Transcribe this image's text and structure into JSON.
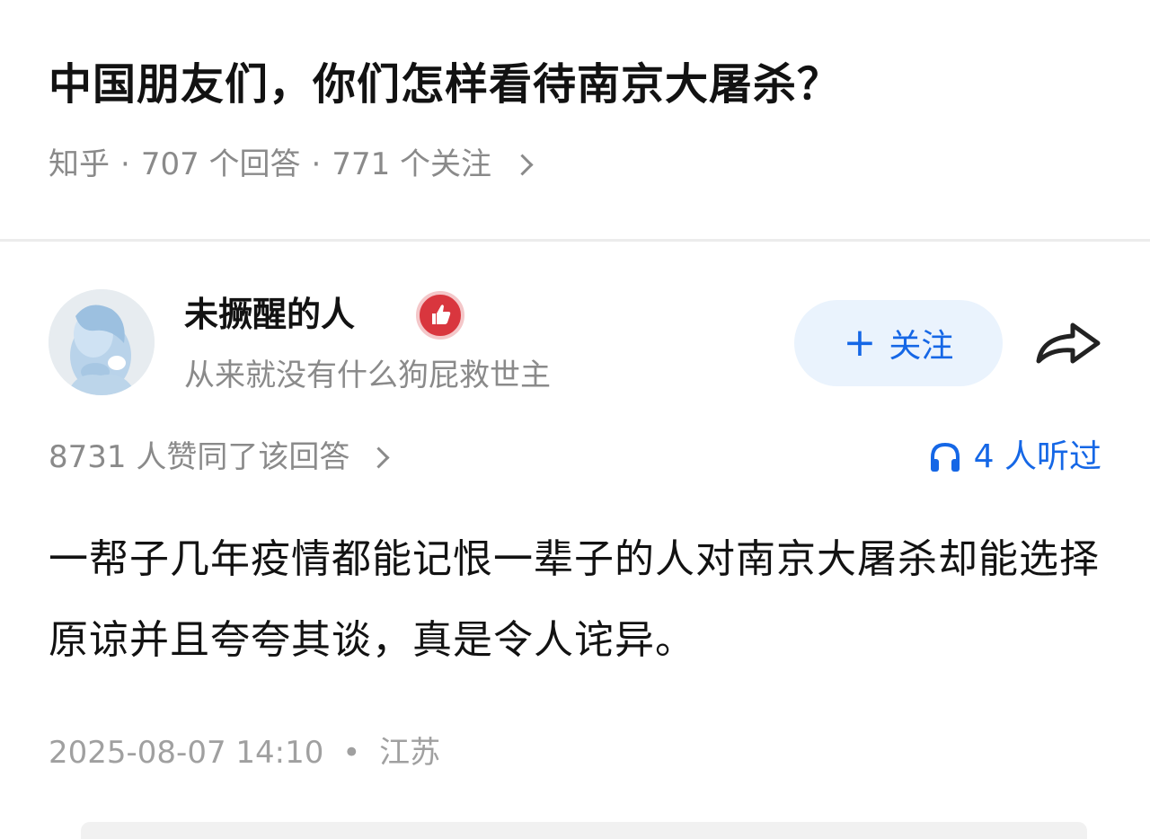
{
  "question": {
    "title": "中国朋友们，你们怎样看待南京大屠杀？",
    "source": "知乎",
    "answers_count": "707 个回答",
    "follow_count": "771 个关注",
    "separator": "·"
  },
  "author": {
    "name": "未撅醒的人",
    "bio": "从来就没有什么狗屁救世主",
    "badge_icon": "thumbs-up-badge-icon",
    "avatar_icon": "anime-avatar"
  },
  "actions": {
    "follow_plus": "+",
    "follow_label": "关注",
    "share_icon": "share-arrow-icon"
  },
  "stats": {
    "votes_text": "8731 人赞同了该回答",
    "listen_text": "4 人听过",
    "listen_icon": "headphones-icon"
  },
  "answer": {
    "text": "一帮子几年疫情都能记恨一辈子的人对南京大屠杀却能选择原谅并且夸夸其谈，真是令人诧异。"
  },
  "footer": {
    "datetime": "2025-08-07 14:10",
    "dot": "•",
    "location": "江苏"
  },
  "colors": {
    "accent": "#1567e6",
    "muted": "#8a8a8a",
    "badge": "#d9363e"
  }
}
